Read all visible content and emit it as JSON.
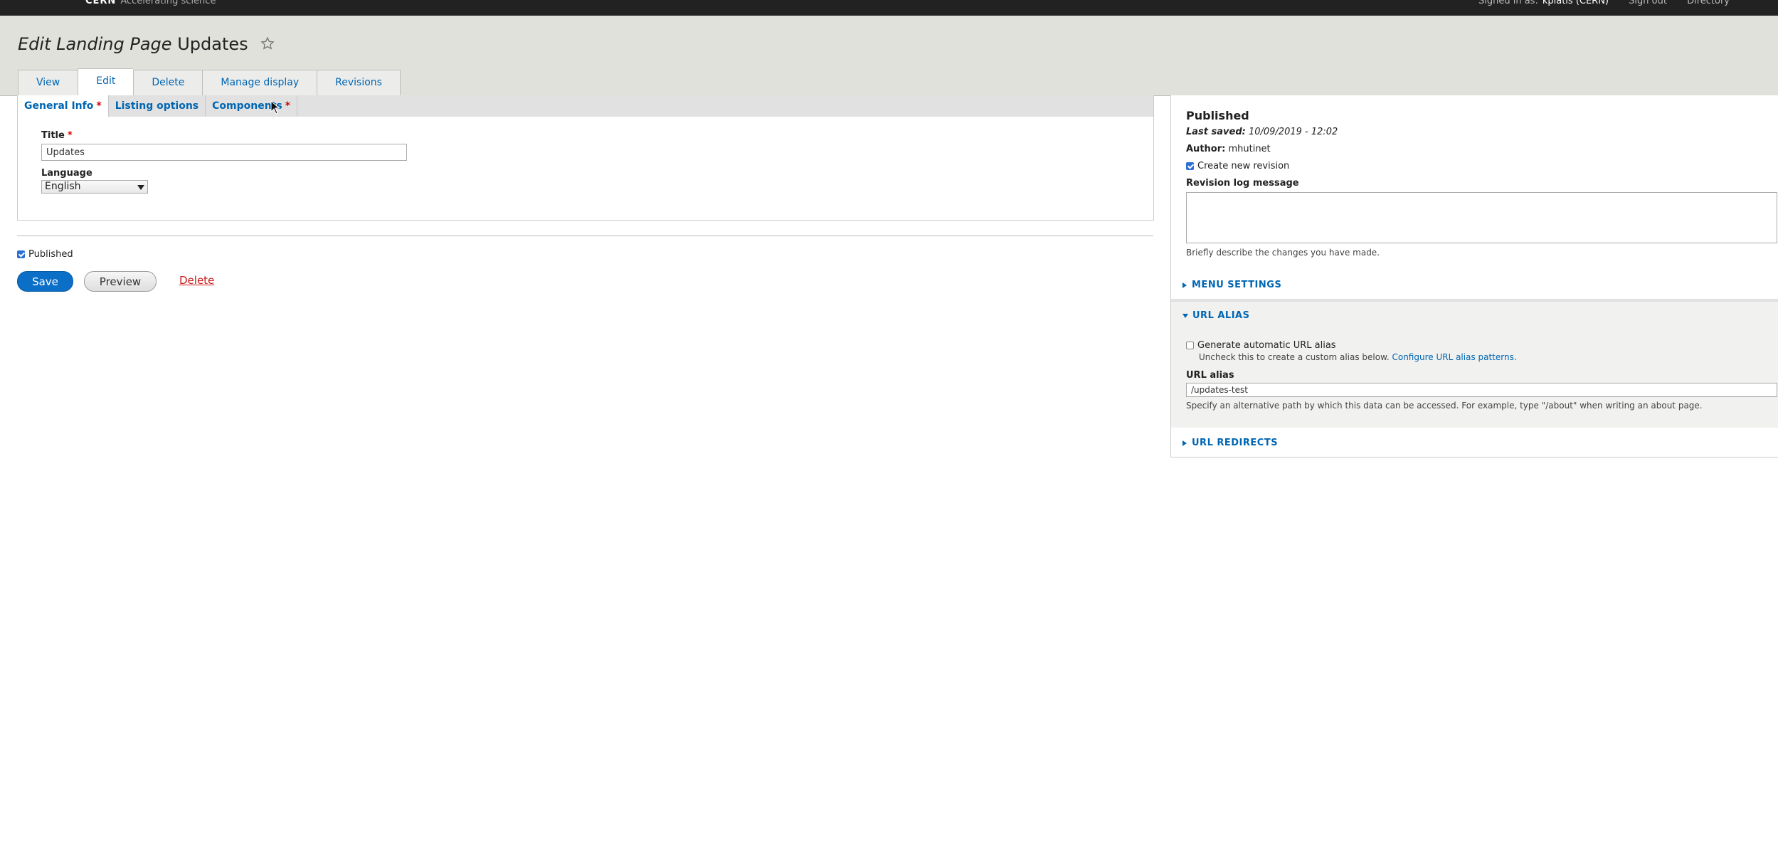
{
  "topbar": {
    "brand": "CERN",
    "brand_tag": "Accelerating science",
    "signed_in_label": "Signed in as:",
    "signed_in_user": "kpiatis (CERN)",
    "sign_out": "Sign out",
    "directory": "Directory"
  },
  "header": {
    "title_prefix": "Edit Landing Page",
    "title_name": "Updates",
    "tabs": [
      {
        "label": "View"
      },
      {
        "label": "Edit"
      },
      {
        "label": "Delete"
      },
      {
        "label": "Manage display"
      },
      {
        "label": "Revisions"
      }
    ]
  },
  "form": {
    "vtabs": [
      {
        "label": "General Info",
        "required": "*"
      },
      {
        "label": "Listing options"
      },
      {
        "label": "Components",
        "required": "*"
      }
    ],
    "title_label": "Title",
    "title_required": "*",
    "title_value": "Updates",
    "language_label": "Language",
    "language_value": "English",
    "published_label": "Published",
    "save": "Save",
    "preview": "Preview",
    "delete": "Delete"
  },
  "sidebar": {
    "status": "Published",
    "last_saved_label": "Last saved:",
    "last_saved_value": "10/09/2019 - 12:02",
    "author_label": "Author:",
    "author_value": "mhutinet",
    "create_revision": "Create new revision",
    "revision_log_label": "Revision log message",
    "revision_hint": "Briefly describe the changes you have made.",
    "menu_settings": "MENU SETTINGS",
    "url_alias_head": "URL ALIAS",
    "generate_alias": "Generate automatic URL alias",
    "generate_hint": "Uncheck this to create a custom alias below.",
    "configure_link": "Configure URL alias patterns.",
    "url_alias_label": "URL alias",
    "url_alias_value": "/updates-test",
    "url_alias_hint": "Specify an alternative path by which this data can be accessed. For example, type \"/about\" when writing an about page.",
    "url_redirects": "URL REDIRECTS"
  },
  "colors": {
    "link": "#0066b3",
    "primary_button": "#0b6fc8",
    "delete_link": "#c91b1b",
    "header_bg": "#e1e1db"
  }
}
